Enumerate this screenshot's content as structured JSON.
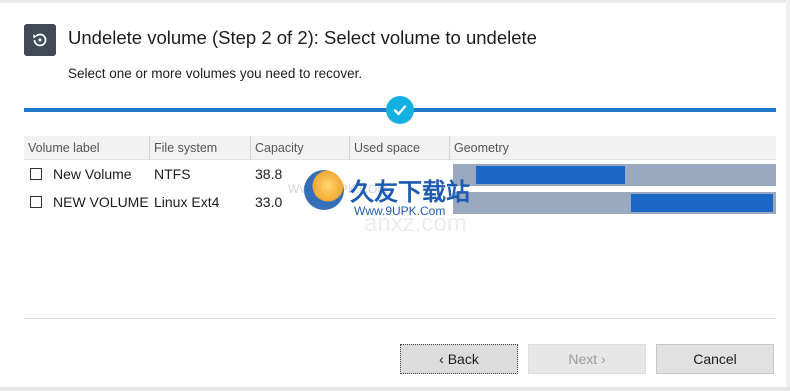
{
  "header": {
    "title": "Undelete volume (Step 2 of 2): Select volume to undelete",
    "subtitle": "Select one or more volumes you need to recover.",
    "icon": "restore-history-icon"
  },
  "progress": {
    "icon": "checkmark-icon",
    "accent_color": "#1e78c8",
    "check_color": "#13b0e0"
  },
  "table": {
    "columns": [
      "Volume label",
      "File system",
      "Capacity",
      "Used space",
      "Geometry"
    ],
    "rows": [
      {
        "label": "New Volume",
        "file_system": "NTFS",
        "capacity": "38.8",
        "checked": false,
        "geometry_start": 0.07,
        "geometry_end": 0.53
      },
      {
        "label": "NEW VOLUME",
        "file_system": "Linux Ext4",
        "capacity": "33.0",
        "checked": false,
        "geometry_start": 0.55,
        "geometry_end": 0.99
      }
    ]
  },
  "watermark": {
    "title": "久友下载站",
    "url": "Www.9UPK.Com",
    "ghost_url": "WWW.9UPK.COM",
    "ghost_text": "anxz.com"
  },
  "buttons": {
    "back": "‹ Back",
    "next": "Next ›",
    "cancel": "Cancel"
  }
}
